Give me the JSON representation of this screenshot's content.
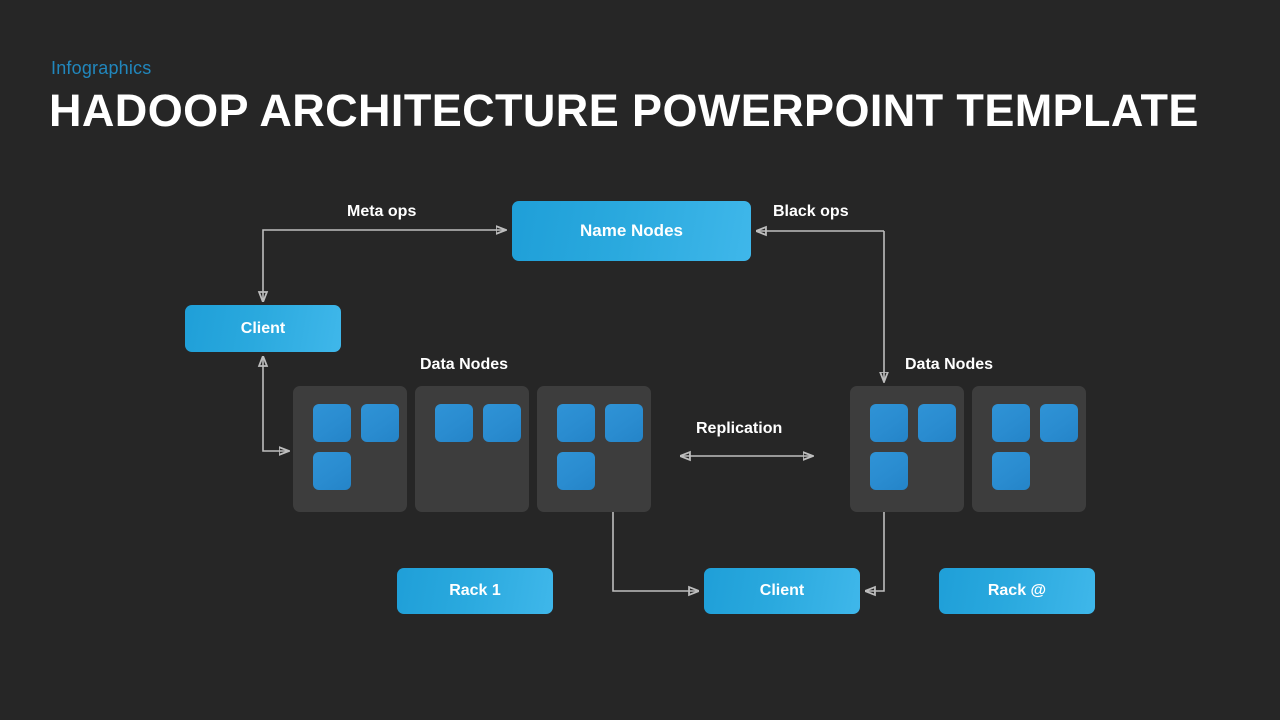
{
  "header": {
    "eyebrow": "Infographics",
    "title": "HADOOP ARCHITECTURE POWERPOINT TEMPLATE"
  },
  "theme": {
    "background": "#262626",
    "accent": "#2187bd",
    "box_blue_start": "#1f9fd8",
    "box_blue_end": "#3fb7ea",
    "rack_fill": "#3d3d3d",
    "node_blue": "#2a8cd0",
    "connector": "#bdbdbd",
    "text": "#ffffff"
  },
  "diagram": {
    "name_nodes": {
      "label": "Name Nodes"
    },
    "client_top": {
      "label": "Client"
    },
    "client_bottom": {
      "label": "Client"
    },
    "rack_left": {
      "label": "Rack 1"
    },
    "rack_right": {
      "label": "Rack @"
    },
    "labels": {
      "meta_ops": "Meta ops",
      "black_ops": "Black ops",
      "data_nodes_left": "Data Nodes",
      "data_nodes_right": "Data Nodes",
      "replication": "Replication"
    },
    "racks_left": [
      {
        "name": "rack-left-1",
        "nodes": 3
      },
      {
        "name": "rack-left-2",
        "nodes": 2
      },
      {
        "name": "rack-left-3",
        "nodes": 3
      }
    ],
    "racks_right": [
      {
        "name": "rack-right-1",
        "nodes": 3
      },
      {
        "name": "rack-right-2",
        "nodes": 3
      }
    ],
    "connectors": [
      {
        "name": "client-to-name-nodes",
        "from": "client_top",
        "to": "name_nodes",
        "label": "Meta ops",
        "arrow": "both"
      },
      {
        "name": "name-nodes-to-data-nodes-right",
        "from": "name_nodes",
        "to": "data_nodes_right",
        "label": "Black ops",
        "arrow": "single"
      },
      {
        "name": "client-top-to-rack-left",
        "from": "client_top",
        "to": "rack_left_group",
        "arrow": "both"
      },
      {
        "name": "replication-link",
        "from": "data_nodes_left",
        "to": "data_nodes_right",
        "label": "Replication",
        "arrow": "both"
      },
      {
        "name": "client-bottom-to-rack-left-3",
        "from": "client_bottom",
        "to": "rack_left_3",
        "arrow": "both"
      },
      {
        "name": "client-bottom-to-rack-right-1",
        "from": "client_bottom",
        "to": "rack_right_1",
        "arrow": "both"
      }
    ]
  }
}
